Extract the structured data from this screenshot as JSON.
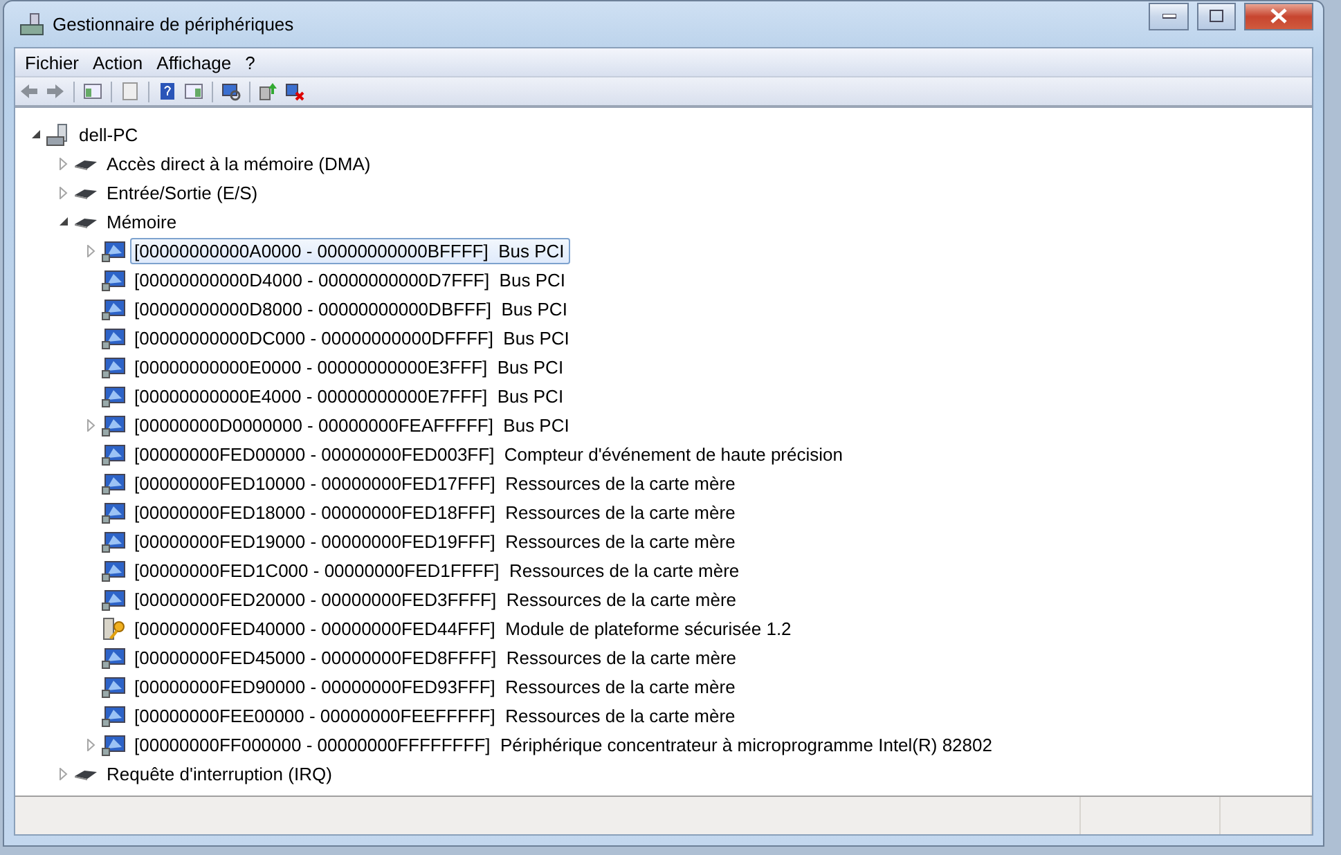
{
  "window": {
    "title": "Gestionnaire de périphériques"
  },
  "menu": [
    "Fichier",
    "Action",
    "Affichage",
    "?"
  ],
  "toolbar": [
    {
      "kind": "back"
    },
    {
      "kind": "forward"
    },
    {
      "kind": "sep"
    },
    {
      "kind": "tree"
    },
    {
      "kind": "sep"
    },
    {
      "kind": "props"
    },
    {
      "kind": "sep"
    },
    {
      "kind": "help"
    },
    {
      "kind": "pane"
    },
    {
      "kind": "sep"
    },
    {
      "kind": "scan"
    },
    {
      "kind": "sep"
    },
    {
      "kind": "update"
    },
    {
      "kind": "remove"
    }
  ],
  "tree": [
    {
      "label": "dell-PC",
      "kind": "computer",
      "expanded": true,
      "selected": false,
      "children": [
        {
          "label": "Accès direct à la mémoire (DMA)",
          "kind": "chip",
          "expanded": false,
          "selected": false
        },
        {
          "label": "Entrée/Sortie (E/S)",
          "kind": "chip",
          "expanded": false,
          "selected": false
        },
        {
          "label": "Mémoire",
          "kind": "chip",
          "expanded": true,
          "selected": false,
          "children": [
            {
              "label": "[00000000000A0000 - 00000000000BFFFF]  Bus PCI",
              "kind": "device",
              "expanded": false,
              "selected": true
            },
            {
              "label": "[00000000000D4000 - 00000000000D7FFF]  Bus PCI",
              "kind": "device",
              "selected": false
            },
            {
              "label": "[00000000000D8000 - 00000000000DBFFF]  Bus PCI",
              "kind": "device",
              "selected": false
            },
            {
              "label": "[00000000000DC000 - 00000000000DFFFF]  Bus PCI",
              "kind": "device",
              "selected": false
            },
            {
              "label": "[00000000000E0000 - 00000000000E3FFF]  Bus PCI",
              "kind": "device",
              "selected": false
            },
            {
              "label": "[00000000000E4000 - 00000000000E7FFF]  Bus PCI",
              "kind": "device",
              "selected": false
            },
            {
              "label": "[00000000D0000000 - 00000000FEAFFFFF]  Bus PCI",
              "kind": "device",
              "expanded": false,
              "selected": false
            },
            {
              "label": "[00000000FED00000 - 00000000FED003FF]  Compteur d'événement de haute précision",
              "kind": "device",
              "selected": false
            },
            {
              "label": "[00000000FED10000 - 00000000FED17FFF]  Ressources de la carte mère",
              "kind": "device",
              "selected": false
            },
            {
              "label": "[00000000FED18000 - 00000000FED18FFF]  Ressources de la carte mère",
              "kind": "device",
              "selected": false
            },
            {
              "label": "[00000000FED19000 - 00000000FED19FFF]  Ressources de la carte mère",
              "kind": "device",
              "selected": false
            },
            {
              "label": "[00000000FED1C000 - 00000000FED1FFFF]  Ressources de la carte mère",
              "kind": "device",
              "selected": false
            },
            {
              "label": "[00000000FED20000 - 00000000FED3FFFF]  Ressources de la carte mère",
              "kind": "device",
              "selected": false
            },
            {
              "label": "[00000000FED40000 - 00000000FED44FFF]  Module de plateforme sécurisée 1.2",
              "kind": "key",
              "selected": false
            },
            {
              "label": "[00000000FED45000 - 00000000FED8FFFF]  Ressources de la carte mère",
              "kind": "device",
              "selected": false
            },
            {
              "label": "[00000000FED90000 - 00000000FED93FFF]  Ressources de la carte mère",
              "kind": "device",
              "selected": false
            },
            {
              "label": "[00000000FEE00000 - 00000000FEEFFFFF]  Ressources de la carte mère",
              "kind": "device",
              "selected": false
            },
            {
              "label": "[00000000FF000000 - 00000000FFFFFFFF]  Périphérique concentrateur à microprogramme Intel(R) 82802",
              "kind": "device",
              "expanded": false,
              "selected": false
            }
          ]
        },
        {
          "label": "Requête d'interruption (IRQ)",
          "kind": "chip",
          "expanded": false,
          "selected": false
        }
      ]
    }
  ]
}
